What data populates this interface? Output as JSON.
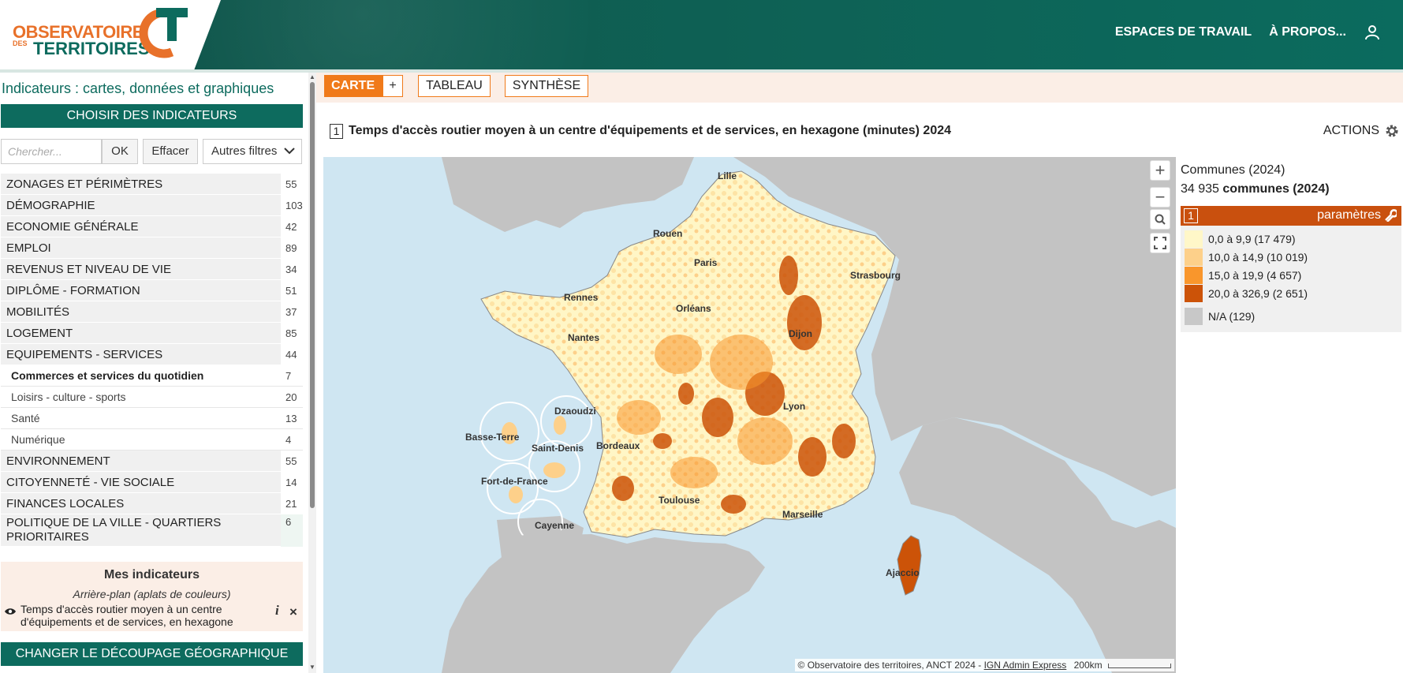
{
  "header": {
    "logo_line1": "OBSERVATOIRE",
    "logo_des": "DES",
    "logo_line2": "TERRITOIRES",
    "nav_workspaces": "ESPACES DE TRAVAIL",
    "nav_about": "À PROPOS...",
    "colors": {
      "brand_green": "#0d6b5e",
      "brand_orange": "#e8712a"
    }
  },
  "sidebar": {
    "title": "Indicateurs : cartes, données et graphiques",
    "choose_button": "CHOISIR DES INDICATEURS",
    "search_placeholder": "Chercher...",
    "ok_button": "OK",
    "clear_button": "Effacer",
    "filters_button": "Autres filtres",
    "categories": [
      {
        "label": "ZONAGES ET PÉRIMÈTRES",
        "count": "55"
      },
      {
        "label": "DÉMOGRAPHIE",
        "count": "103"
      },
      {
        "label": "ECONOMIE GÉNÉRALE",
        "count": "42"
      },
      {
        "label": "EMPLOI",
        "count": "89"
      },
      {
        "label": "REVENUS ET NIVEAU DE VIE",
        "count": "34"
      },
      {
        "label": "DIPLÔME - FORMATION",
        "count": "51"
      },
      {
        "label": "MOBILITÉS",
        "count": "37"
      },
      {
        "label": "LOGEMENT",
        "count": "85"
      },
      {
        "label": "EQUIPEMENTS - SERVICES",
        "count": "44"
      }
    ],
    "subcategories": [
      {
        "label": "Commerces et services du quotidien",
        "count": "7"
      },
      {
        "label": "Loisirs - culture - sports",
        "count": "20"
      },
      {
        "label": "Santé",
        "count": "13"
      },
      {
        "label": "Numérique",
        "count": "4"
      }
    ],
    "categories2": [
      {
        "label": "ENVIRONNEMENT",
        "count": "55"
      },
      {
        "label": "CITOYENNETÉ - VIE SOCIALE",
        "count": "14"
      },
      {
        "label": "FINANCES LOCALES",
        "count": "21"
      }
    ],
    "politique": {
      "label_line1": "POLITIQUE DE LA VILLE - QUARTIERS",
      "label_line2": "PRIORITAIRES",
      "count": "6"
    },
    "my_indicators": {
      "title": "Mes indicateurs",
      "subtitle": "Arrière-plan (aplats de couleurs)",
      "item_line1": "Temps d'accès routier moyen à un centre",
      "item_line2": "d'équipements et de services, en hexagone"
    },
    "change_button": "CHANGER LE DÉCOUPAGE GÉOGRAPHIQUE"
  },
  "tabs": {
    "carte": "CARTE",
    "plus": "+",
    "tableau": "TABLEAU",
    "synthese": "SYNTHÈSE"
  },
  "indicator": {
    "number": "1",
    "title": "Temps d'accès routier moyen à un centre d'équipements et de services, en hexagone (minutes) 2024",
    "actions": "ACTIONS"
  },
  "map": {
    "cities": [
      "Lille",
      "Rouen",
      "Paris",
      "Strasbourg",
      "Rennes",
      "Orléans",
      "Nantes",
      "Dijon",
      "Lyon",
      "Bordeaux",
      "Toulouse",
      "Marseille",
      "Ajaccio"
    ],
    "overseas": [
      "Dzaoudzi",
      "Basse-Terre",
      "Saint-Denis",
      "Fort-de-France",
      "Cayenne"
    ],
    "attribution": "© Observatoire des territoires, ANCT 2024 - ",
    "attribution_link": "IGN Admin Express",
    "scale": "200km",
    "controls": [
      "zoom-in",
      "zoom-out",
      "search",
      "fullscreen"
    ]
  },
  "legend": {
    "unit_label": "Communes (2024)",
    "count_prefix": "34 935 ",
    "count_bold": "communes (2024)",
    "number": "1",
    "params": "paramètres",
    "classes": [
      {
        "label": "0,0 à 9,9 (17 479)",
        "color": "#fff7c8"
      },
      {
        "label": "10,0 à 14,9 (10 019)",
        "color": "#fdd08a"
      },
      {
        "label": "15,0 à 19,9 (4 657)",
        "color": "#f9962c"
      },
      {
        "label": "20,0 à 326,9 (2 651)",
        "color": "#cc5308"
      },
      {
        "label": "N/A (129)",
        "color": "#c8c8c8"
      }
    ]
  }
}
